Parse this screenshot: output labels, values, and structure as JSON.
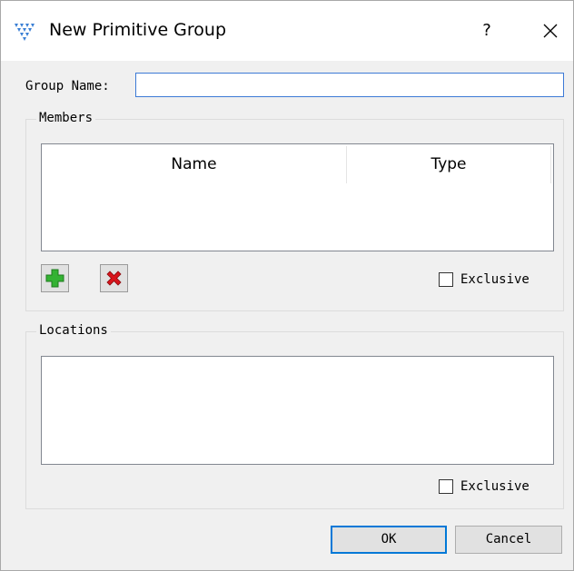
{
  "window": {
    "title": "New Primitive Group",
    "help_label": "?",
    "icon": "gowin-logo-icon"
  },
  "group_name": {
    "label": "Group Name:",
    "value": ""
  },
  "members": {
    "legend": "Members",
    "columns": [
      "Name",
      "Type"
    ],
    "rows": [],
    "add_icon": "plus-icon",
    "remove_icon": "x-icon",
    "exclusive_label": "Exclusive",
    "exclusive_checked": false
  },
  "locations": {
    "legend": "Locations",
    "items": [],
    "exclusive_label": "Exclusive",
    "exclusive_checked": false
  },
  "footer": {
    "ok_label": "OK",
    "cancel_label": "Cancel"
  },
  "colors": {
    "accent": "#0078d7",
    "add_green": "#34b233",
    "remove_red": "#d8141b"
  }
}
